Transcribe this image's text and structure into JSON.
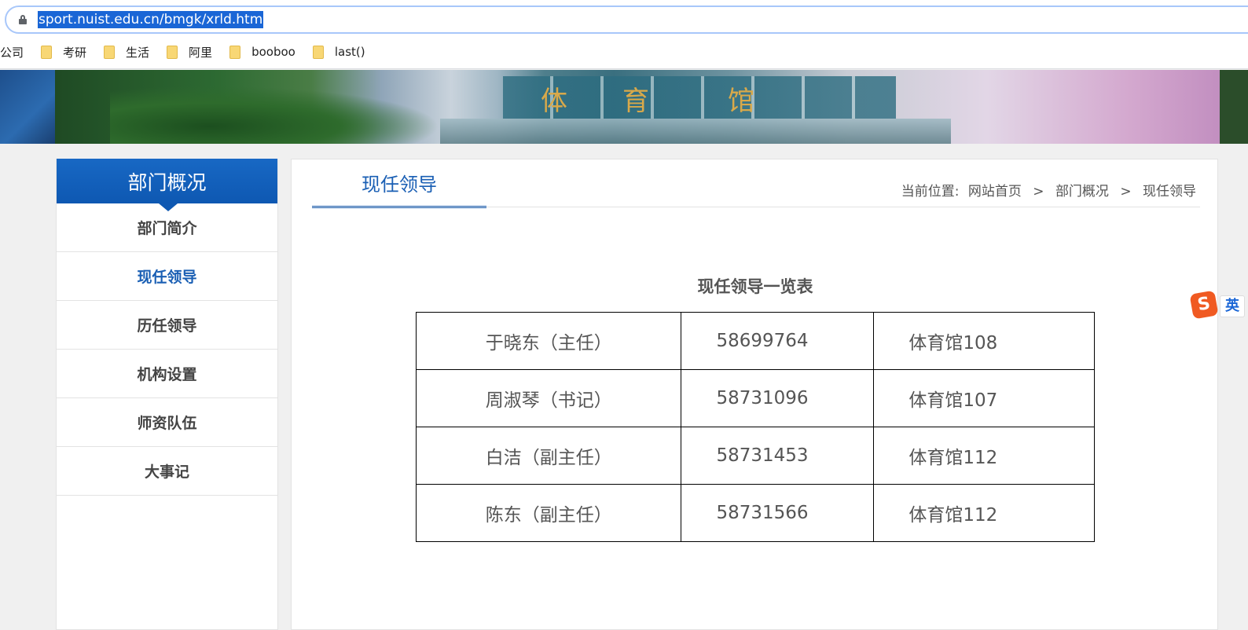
{
  "browser": {
    "url": "sport.nuist.edu.cn/bmgk/xrld.htm",
    "bookmarks": [
      "公司",
      "考研",
      "生活",
      "阿里",
      "booboo",
      "last()"
    ]
  },
  "banner": {
    "building_chars": [
      "体",
      "育",
      "馆"
    ]
  },
  "sidebar": {
    "title": "部门概况",
    "items": [
      {
        "label": "部门简介",
        "active": false
      },
      {
        "label": "现任领导",
        "active": true
      },
      {
        "label": "历任领导",
        "active": false
      },
      {
        "label": "机构设置",
        "active": false
      },
      {
        "label": "师资队伍",
        "active": false
      },
      {
        "label": "大事记",
        "active": false
      }
    ]
  },
  "main": {
    "tab_label": "现任领导",
    "breadcrumb": {
      "prefix": "当前位置:",
      "home": "网站首页",
      "section": "部门概况",
      "current": "现任领导",
      "separator": ">"
    },
    "table_title": "现任领导一览表",
    "rows": [
      {
        "name": "于晓东（主任）",
        "phone": "58699764",
        "office": "体育馆108"
      },
      {
        "name": "周淑琴（书记）",
        "phone": "58731096",
        "office": "体育馆107"
      },
      {
        "name": "白洁（副主任）",
        "phone": "58731453",
        "office": "体育馆112"
      },
      {
        "name": "陈东（副主任）",
        "phone": "58731566",
        "office": "体育馆112"
      }
    ]
  },
  "ime": {
    "logo": "S",
    "mode": "英"
  },
  "colors": {
    "accent": "#1a5fb4",
    "sidebar_head": "#0e58b2"
  }
}
